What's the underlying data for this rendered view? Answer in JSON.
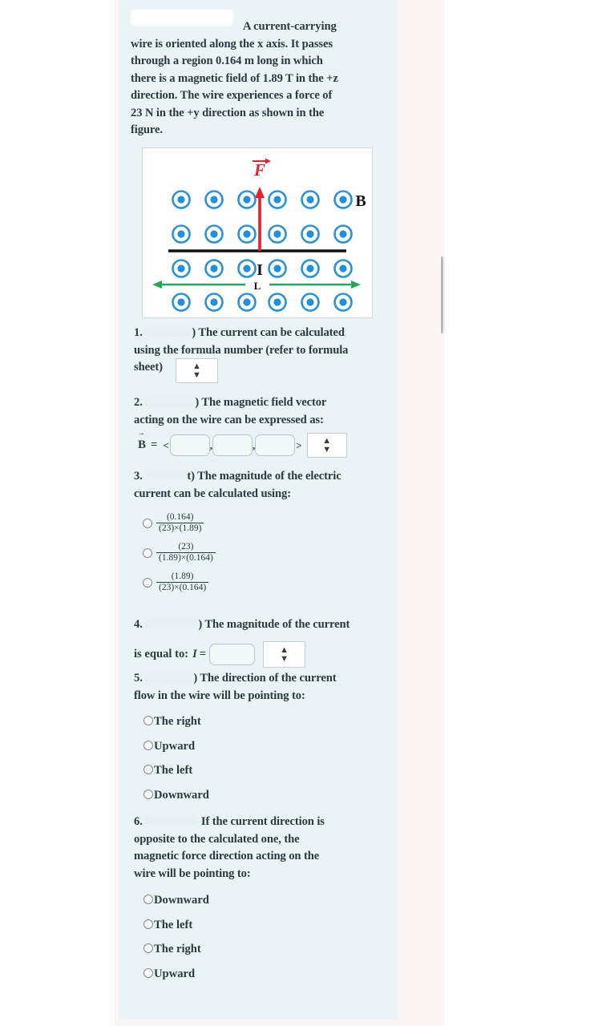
{
  "document": {
    "problem_text": "A current-carrying wire is oriented along the x axis. It passes through a region 0.164 m long in which there is a magnetic field of 1.89 T in the +z direction. The wire experiences a force of 23 N in the +y direction as shown in the figure.",
    "problem_line1_tail": "A current-carrying",
    "problem_line2": "wire is oriented along the x axis. It passes",
    "problem_line3": "through a region 0.164 m long in which",
    "problem_line4": "there is a magnetic field of 1.89 T in the +z",
    "problem_line5": "direction. The wire experiences a force of",
    "problem_line6": "23 N in the +y direction as shown in the",
    "problem_line7": "figure."
  },
  "figure": {
    "force_label": "F",
    "field_label": "B",
    "current_label": "I",
    "length_label": "L",
    "field_symbol": "dot-out-of-page",
    "dot_rows": 4,
    "dot_cols": 6,
    "colors": {
      "field_dot": "#1f8fe0",
      "field_ring": "#2a93d6",
      "force_arrow": "#e8202a",
      "wire": "#111111",
      "length_arrow": "#1fa856"
    }
  },
  "questions": [
    {
      "number": "1.",
      "marks_redacted": true,
      "line1": ") The current can be calculated",
      "line2": "using the formula number (refer to formula",
      "line3_prefix": "sheet)",
      "control": "dropdown",
      "value": ""
    },
    {
      "number": "2.",
      "marks_redacted": true,
      "line1": ") The magnetic field vector",
      "line2": "acting on the wire can be expressed as:",
      "vector_label": "B",
      "equals": "=",
      "open_bracket": "<",
      "close_bracket": ">",
      "separator": ",",
      "components": [
        "",
        "",
        ""
      ],
      "unit_dropdown": ""
    },
    {
      "number": "3.",
      "marks_redacted": true,
      "redacted_tail": "t)",
      "line1": " The magnitude of the electric",
      "line2": "current can be calculated using:",
      "options": [
        {
          "numerator": "(0.164)",
          "denominator": "(23)×(1.89)",
          "selected": false
        },
        {
          "numerator": "(23)",
          "denominator": "(1.89)×(0.164)",
          "selected": false
        },
        {
          "numerator": "(1.89)",
          "denominator": "(23)×(0.164)",
          "selected": false
        }
      ]
    },
    {
      "number": "4.",
      "marks_redacted": true,
      "line1": ") The magnitude of the current",
      "line2_prefix": "is equal to:",
      "symbol": "I",
      "equals": "=",
      "value": "",
      "unit_dropdown": ""
    },
    {
      "number": "5.",
      "marks_redacted": true,
      "line1": ") The direction of the current",
      "line2": "flow in the wire will be pointing to:",
      "options": [
        "The right",
        "Upward",
        "The left",
        "Downward"
      ],
      "selected": null
    },
    {
      "number": "6.",
      "marks_redacted": true,
      "line1": " If the current direction is",
      "line2": "opposite to the calculated one, the",
      "line3": "magnetic force direction acting on the",
      "line4": "wire will be pointing to:",
      "options": [
        "Downward",
        "The left",
        "The right",
        "Upward"
      ],
      "selected": null
    }
  ],
  "scrollbar": {
    "present": true
  }
}
